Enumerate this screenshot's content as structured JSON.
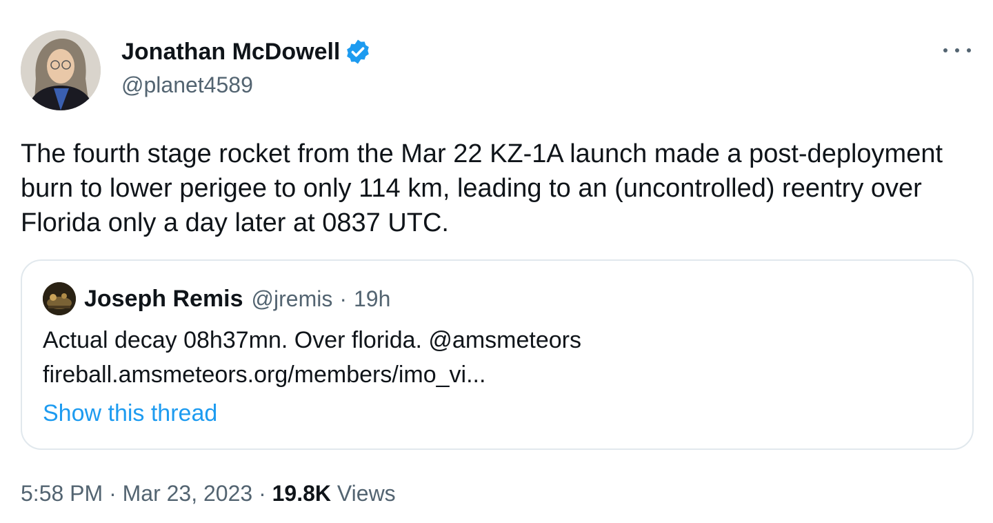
{
  "author": {
    "name": "Jonathan McDowell",
    "handle": "@planet4589",
    "verified_color": "#1d9bf0"
  },
  "tweet": {
    "text": "The fourth stage rocket from the Mar 22 KZ-1A launch made a post-deployment burn to lower perigee to only 114 km, leading to an (uncontrolled) reentry over Florida only a day later at 0837 UTC.",
    "more_icon": "more-horizontal-icon"
  },
  "quote": {
    "name": "Joseph Remis",
    "handle": "@jremis",
    "separator": "·",
    "time": "19h",
    "text_line1": "Actual decay 08h37mn. Over florida. @amsmeteors",
    "text_line2": "fireball.amsmeteors.org/members/imo_vi...",
    "show_thread": "Show this thread"
  },
  "footer": {
    "time": "5:58 PM",
    "sep1": "·",
    "date": "Mar 23, 2023",
    "sep2": "·",
    "views_count": "19.8K",
    "views_label": "Views"
  },
  "colors": {
    "link": "#1d9bf0",
    "secondary_text": "#536471",
    "primary_text": "#0f1419",
    "border": "#e1e8ed"
  }
}
